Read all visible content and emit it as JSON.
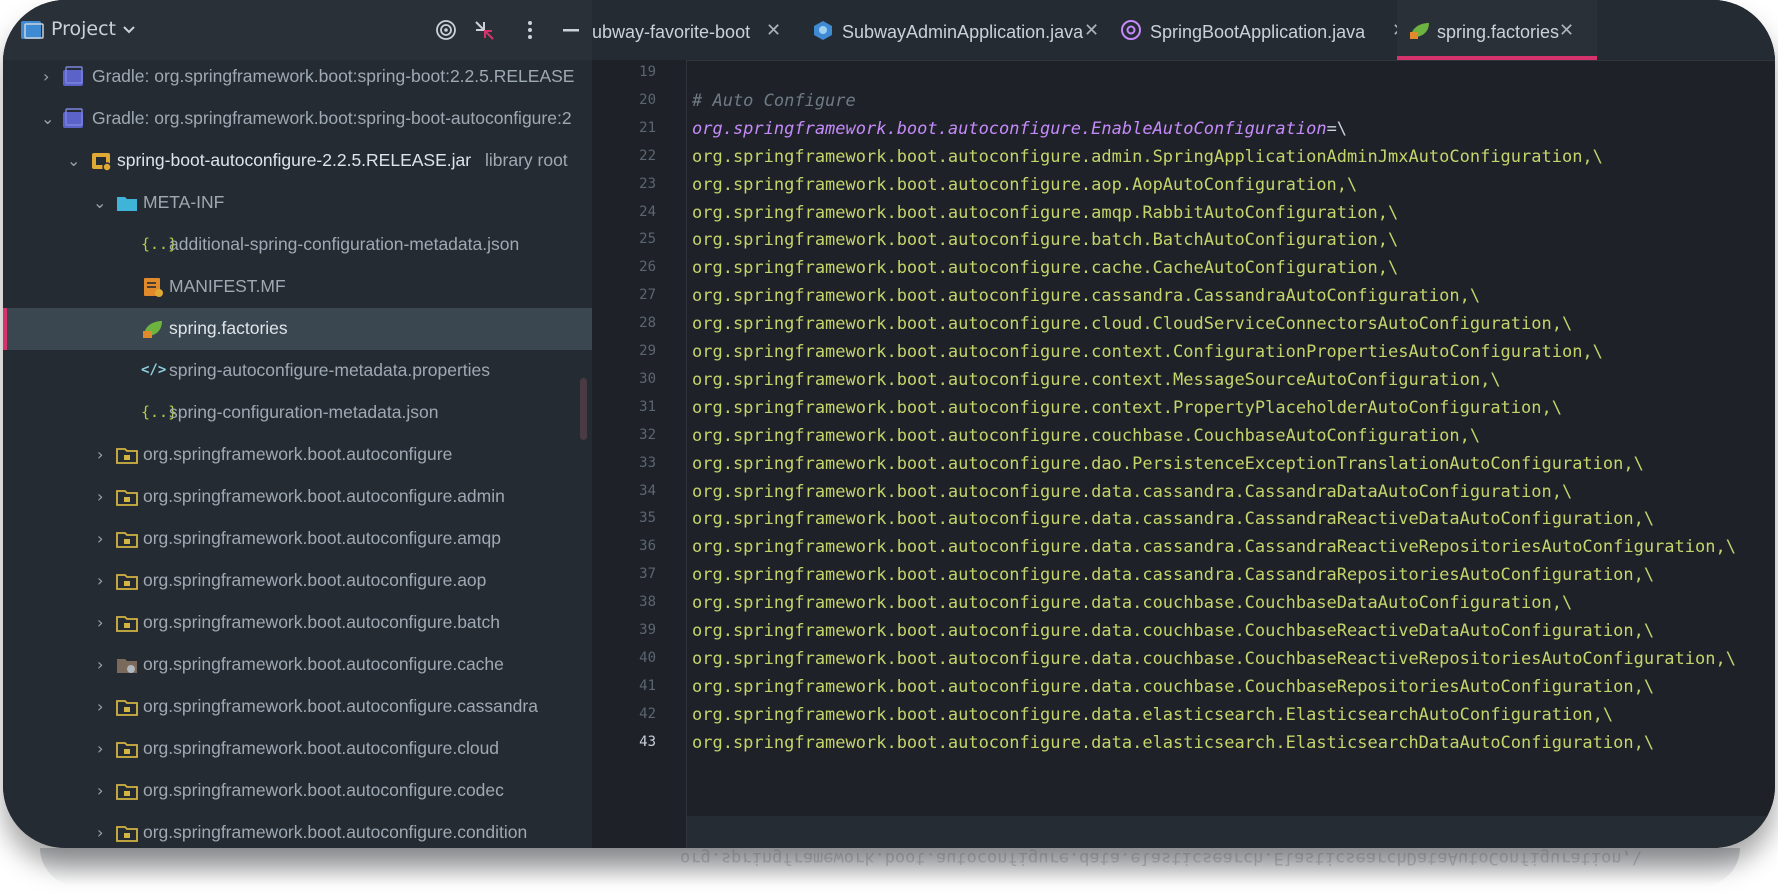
{
  "project": {
    "title": "Project",
    "tree": [
      {
        "label": "Gradle: org.springframework.boot:spring-boot:2.2.5.RELEASE"
      },
      {
        "label": "Gradle: org.springframework.boot:spring-boot-autoconfigure:2"
      },
      {
        "label": "spring-boot-autoconfigure-2.2.5.RELEASE.jar",
        "suffix": "library root"
      },
      {
        "label": "META-INF"
      },
      {
        "label": "additional-spring-configuration-metadata.json"
      },
      {
        "label": "MANIFEST.MF"
      },
      {
        "label": "spring.factories"
      },
      {
        "label": "spring-autoconfigure-metadata.properties"
      },
      {
        "label": "spring-configuration-metadata.json"
      },
      {
        "label": "org.springframework.boot.autoconfigure"
      },
      {
        "label": "org.springframework.boot.autoconfigure.admin"
      },
      {
        "label": "org.springframework.boot.autoconfigure.amqp"
      },
      {
        "label": "org.springframework.boot.autoconfigure.aop"
      },
      {
        "label": "org.springframework.boot.autoconfigure.batch"
      },
      {
        "label": "org.springframework.boot.autoconfigure.cache"
      },
      {
        "label": "org.springframework.boot.autoconfigure.cassandra"
      },
      {
        "label": "org.springframework.boot.autoconfigure.cloud"
      },
      {
        "label": "org.springframework.boot.autoconfigure.codec"
      },
      {
        "label": "org.springframework.boot.autoconfigure.condition"
      }
    ]
  },
  "tabs": [
    {
      "label": "ubway-favorite-boot",
      "close": "✕"
    },
    {
      "label": "SubwayAdminApplication.java",
      "close": "✕"
    },
    {
      "label": "SpringBootApplication.java",
      "close": "✕"
    },
    {
      "label": "spring.factories",
      "close": "✕"
    }
  ],
  "editor": {
    "first_line": "19",
    "comment": "# Auto Configure",
    "key": "org.springframework.boot.autoconfigure.EnableAutoConfiguration",
    "key_suffix": "=\\",
    "lines": [
      "org.springframework.boot.autoconfigure.admin.SpringApplicationAdminJmxAutoConfiguration,\\",
      "org.springframework.boot.autoconfigure.aop.AopAutoConfiguration,\\",
      "org.springframework.boot.autoconfigure.amqp.RabbitAutoConfiguration,\\",
      "org.springframework.boot.autoconfigure.batch.BatchAutoConfiguration,\\",
      "org.springframework.boot.autoconfigure.cache.CacheAutoConfiguration,\\",
      "org.springframework.boot.autoconfigure.cassandra.CassandraAutoConfiguration,\\",
      "org.springframework.boot.autoconfigure.cloud.CloudServiceConnectorsAutoConfiguration,\\",
      "org.springframework.boot.autoconfigure.context.ConfigurationPropertiesAutoConfiguration,\\",
      "org.springframework.boot.autoconfigure.context.MessageSourceAutoConfiguration,\\",
      "org.springframework.boot.autoconfigure.context.PropertyPlaceholderAutoConfiguration,\\",
      "org.springframework.boot.autoconfigure.couchbase.CouchbaseAutoConfiguration,\\",
      "org.springframework.boot.autoconfigure.dao.PersistenceExceptionTranslationAutoConfiguration,\\",
      "org.springframework.boot.autoconfigure.data.cassandra.CassandraDataAutoConfiguration,\\",
      "org.springframework.boot.autoconfigure.data.cassandra.CassandraReactiveDataAutoConfiguration,\\",
      "org.springframework.boot.autoconfigure.data.cassandra.CassandraReactiveRepositoriesAutoConfiguration,\\",
      "org.springframework.boot.autoconfigure.data.cassandra.CassandraRepositoriesAutoConfiguration,\\",
      "org.springframework.boot.autoconfigure.data.couchbase.CouchbaseDataAutoConfiguration,\\",
      "org.springframework.boot.autoconfigure.data.couchbase.CouchbaseReactiveDataAutoConfiguration,\\",
      "org.springframework.boot.autoconfigure.data.couchbase.CouchbaseReactiveRepositoriesAutoConfiguration,\\",
      "org.springframework.boot.autoconfigure.data.couchbase.CouchbaseRepositoriesAutoConfiguration,\\",
      "org.springframework.boot.autoconfigure.data.elasticsearch.ElasticsearchAutoConfiguration,\\",
      "org.springframework.boot.autoconfigure.data.elasticsearch.ElasticsearchDataAutoConfiguration,\\"
    ],
    "line_numbers": [
      "19",
      "20",
      "21",
      "22",
      "23",
      "24",
      "25",
      "26",
      "27",
      "28",
      "29",
      "30",
      "31",
      "32",
      "33",
      "34",
      "35",
      "36",
      "37",
      "38",
      "39",
      "40",
      "41",
      "42",
      "43"
    ]
  },
  "colors": {
    "accent": "#d6336c",
    "code": "#c2d56b",
    "key": "#c58af9",
    "comment": "#6f7a84"
  },
  "icons": {
    "project_panel": "folder-icon",
    "header_actions": [
      "target-icon",
      "collapse-icon",
      "more-vertical-icon",
      "minimize-icon"
    ]
  }
}
